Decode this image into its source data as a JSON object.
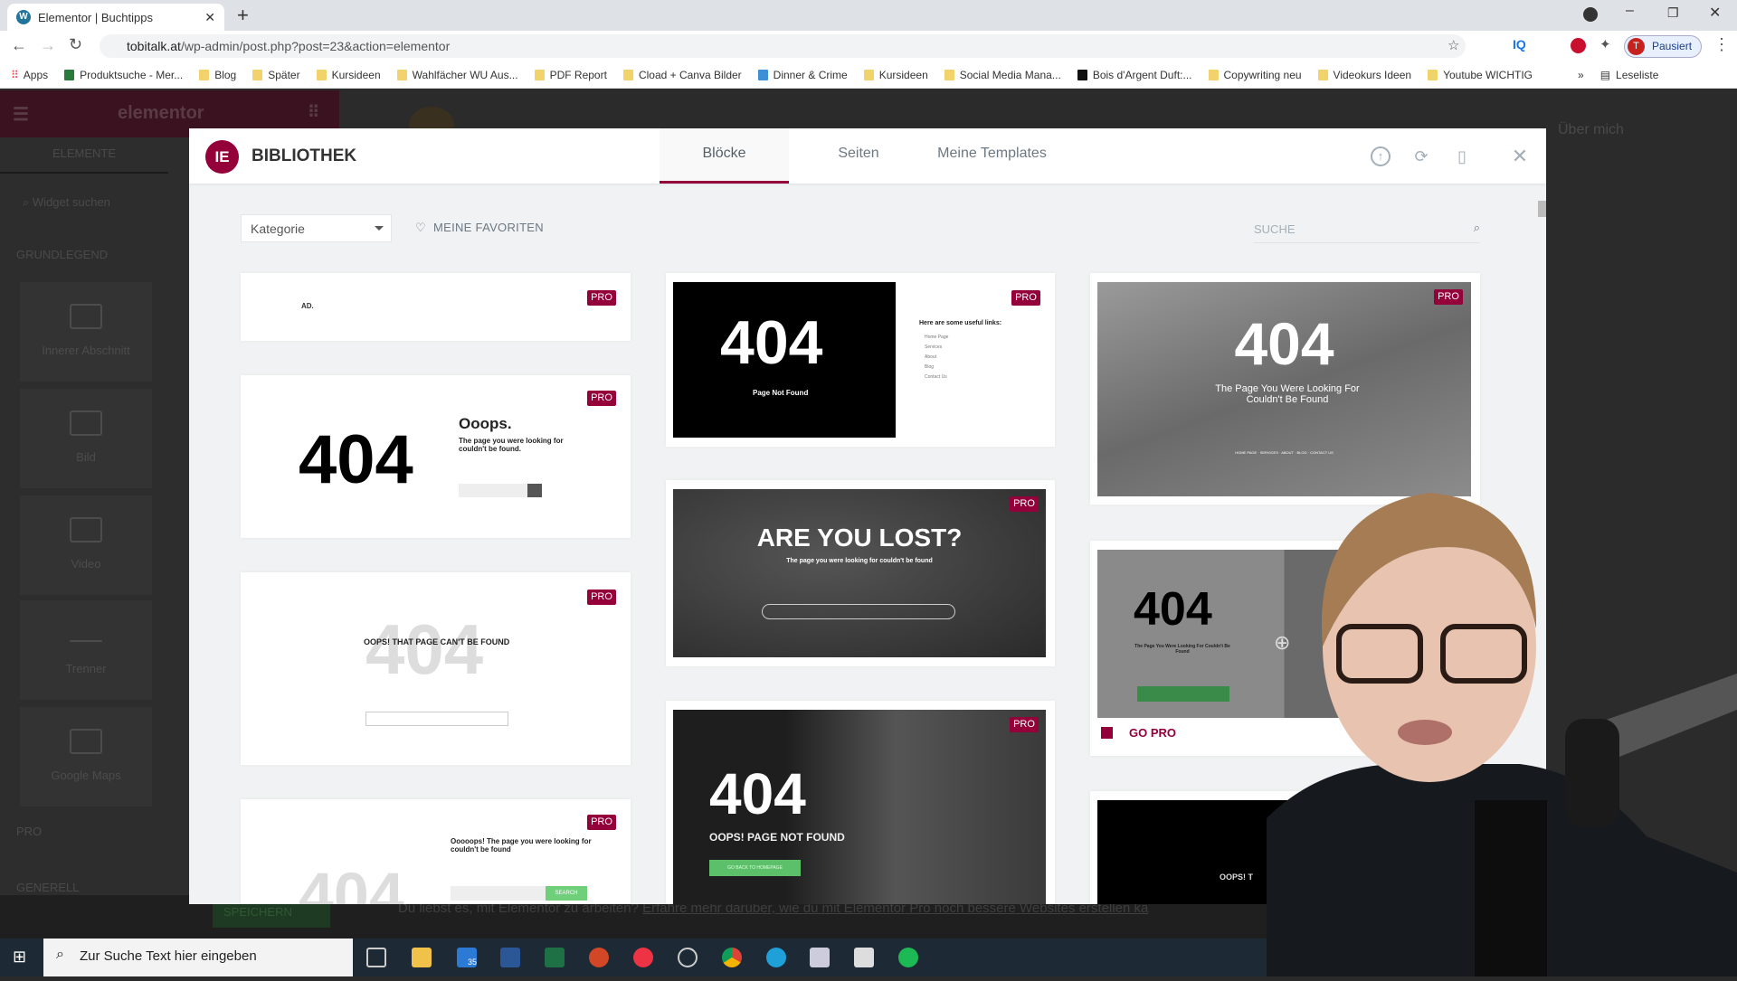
{
  "browser": {
    "tab_title": "Elementor | Buchtipps",
    "url_domain": "tobitalk.at",
    "url_path": "/wp-admin/post.php?post=23&action=elementor",
    "profile_label": "Pausiert",
    "profile_initial": "T",
    "bookmarks": [
      "Apps",
      "Produktsuche - Mer...",
      "Blog",
      "Später",
      "Kursideen",
      "Wahlfächer WU Aus...",
      "PDF Report",
      "Cload + Canva Bilder",
      "Dinner & Crime",
      "Kursideen",
      "Social Media Mana...",
      "Bois d'Argent Duft:...",
      "Copywriting neu",
      "Videokurs Ideen",
      "Youtube WICHTIG"
    ],
    "reading_list": "Leseliste"
  },
  "elementor": {
    "logo": "elementor",
    "tab": "ELEMENTE",
    "search_placeholder": "Widget suchen",
    "section_basic": "GRUNDLEGEND",
    "widgets": [
      "Innerer Abschnitt",
      "Bild",
      "Video",
      "Trenner",
      "Google Maps"
    ],
    "section_pro": "PRO",
    "section_general": "GENERELL",
    "save_label": "SPEICHERN",
    "notice": "Du liebst es, mit Elementor zu arbeiten?",
    "notice_link": "Erfahre mehr darüber, wie du mit Elementor Pro noch bessere Websites erstellen ka",
    "nav_item": "Über mich"
  },
  "library": {
    "title": "BIBLIOTHEK",
    "tabs": [
      "Blöcke",
      "Seiten",
      "Meine Templates"
    ],
    "active_tab": 0,
    "category_label": "Kategorie",
    "favorites_label": "MEINE FAVORITEN",
    "search_placeholder": "SUCHE",
    "pro_badge": "PRO",
    "go_pro": "GO PRO",
    "accent": "#93003a",
    "cards": {
      "c1a": {
        "logo": "AD."
      },
      "c1b": {
        "big": "404",
        "title": "Ooops.",
        "sub": "The page you were looking for couldn't be found."
      },
      "c1c": {
        "big": "404",
        "title": "OOPS! THAT PAGE CAN'T BE FOUND"
      },
      "c1d": {
        "big": "404",
        "title": "Ooooops! The page you were looking for couldn't be found",
        "button": "SEARCH"
      },
      "c2a": {
        "big": "404",
        "sub": "Page Not Found",
        "links_title": "Here are some useful links:",
        "links": [
          "Home Page",
          "Services",
          "About",
          "Blog",
          "Contact Us"
        ]
      },
      "c2b": {
        "title": "ARE YOU LOST?",
        "sub": "The page you were looking for couldn't be found"
      },
      "c2c": {
        "big": "404",
        "sub": "OOPS! PAGE NOT FOUND",
        "button": "GO BACK TO HOMEPAGE"
      },
      "c3a": {
        "big": "404",
        "sub": "The Page You Were Looking For Couldn't Be Found",
        "nav": "HOME PAGE · SERVICES · ABOUT · BLOG · CONTACT US"
      },
      "c3b": {
        "big": "404",
        "sub": "The Page You Were Looking For Couldn't Be Found"
      },
      "c3c": {
        "sub": "OOPS! T"
      }
    }
  },
  "taskbar": {
    "search_placeholder": "Zur Suche Text hier eingeben",
    "mail_badge": "35"
  }
}
